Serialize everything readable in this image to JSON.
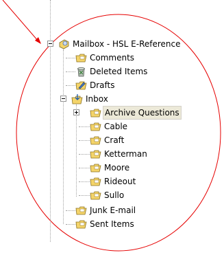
{
  "folder_tree": {
    "root": {
      "label": "Mailbox - HSL E-Reference",
      "icon": "mailbox-icon",
      "expanded": true
    },
    "items": [
      {
        "label": "Comments",
        "icon": "folder-icon"
      },
      {
        "label": "Deleted Items",
        "icon": "deleted-items-icon"
      },
      {
        "label": "Drafts",
        "icon": "drafts-icon"
      },
      {
        "label": "Inbox",
        "icon": "inbox-icon",
        "expanded": true,
        "children": [
          {
            "label": "Archive Questions",
            "icon": "folder-icon",
            "selected": true,
            "expandable": true
          },
          {
            "label": "Cable",
            "icon": "folder-icon"
          },
          {
            "label": "Craft",
            "icon": "folder-icon"
          },
          {
            "label": "Ketterman",
            "icon": "folder-icon"
          },
          {
            "label": "Moore",
            "icon": "folder-icon"
          },
          {
            "label": "Rideout",
            "icon": "folder-icon"
          },
          {
            "label": "Sullo",
            "icon": "folder-icon"
          }
        ]
      },
      {
        "label": "Junk E-mail",
        "icon": "folder-icon"
      },
      {
        "label": "Sent Items",
        "icon": "folder-icon"
      }
    ]
  },
  "colors": {
    "annotation": "#e60000",
    "selection": "#ece9d8",
    "folder": "#f4d46a"
  }
}
